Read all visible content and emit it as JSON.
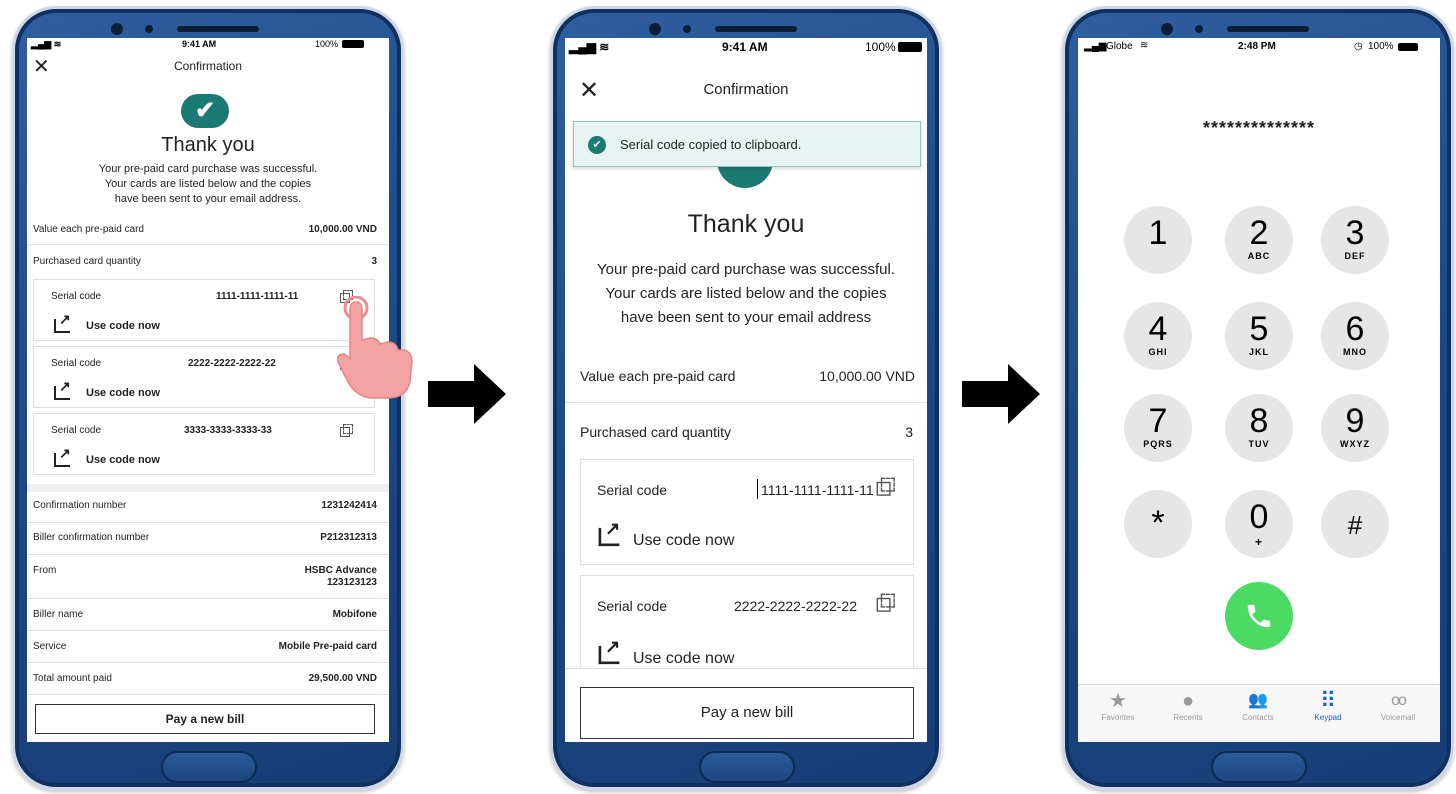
{
  "phone1": {
    "status": {
      "time": "9:41 AM",
      "battery": "100%"
    },
    "header": {
      "close": "✕",
      "title": "Confirmation"
    },
    "thank_title": "Thank you",
    "message": [
      "Your pre-paid card purchase was successful.",
      "Your cards are listed below and the copies",
      "have been sent to your email address."
    ],
    "value_label": "Value each pre-paid card",
    "value": "10,000.00 VND",
    "qty_label": "Purchased card quantity",
    "qty": "3",
    "cards": [
      {
        "label": "Serial code",
        "code": "1111-1111-1111-11",
        "use": "Use code now"
      },
      {
        "label": "Serial code",
        "code": "2222-2222-2222-22",
        "use": "Use code now"
      },
      {
        "label": "Serial code",
        "code": "3333-3333-3333-33",
        "use": "Use code now"
      }
    ],
    "details": [
      {
        "label": "Confirmation number",
        "value": "1231242414"
      },
      {
        "label": "Biller confirmation number",
        "value": "P212312313"
      },
      {
        "label": "From",
        "value": "HSBC Advance",
        "value2": "123123123"
      },
      {
        "label": "Biller name",
        "value": "Mobifone"
      },
      {
        "label": "Service",
        "value": "Mobile Pre-paid card"
      },
      {
        "label": "Total amount paid",
        "value": "29,500.00 VND"
      }
    ],
    "pay_button": "Pay a new bill"
  },
  "phone2": {
    "status": {
      "time": "9:41 AM",
      "battery": "100%"
    },
    "header": {
      "close": "✕",
      "title": "Confirmation"
    },
    "toast": "Serial code copied to clipboard.",
    "thank_title": "Thank you",
    "message": [
      "Your pre-paid card purchase was successful.",
      "Your cards are listed below and the copies",
      "have been sent to your email address"
    ],
    "value_label": "Value each pre-paid card",
    "value": "10,000.00 VND",
    "qty_label": "Purchased card quantity",
    "qty": "3",
    "cards": [
      {
        "label": "Serial code",
        "code": "1111-1111-1111-11",
        "use": "Use code now"
      },
      {
        "label": "Serial code",
        "code": "2222-2222-2222-22",
        "use": "Use code now"
      }
    ],
    "pay_button": "Pay a new bill"
  },
  "phone3": {
    "status": {
      "carrier": "Globe",
      "time": "2:48 PM",
      "battery": "100%"
    },
    "entry": "**************",
    "keys": [
      {
        "num": "1",
        "letters": ""
      },
      {
        "num": "2",
        "letters": "ABC"
      },
      {
        "num": "3",
        "letters": "DEF"
      },
      {
        "num": "4",
        "letters": "GHI"
      },
      {
        "num": "5",
        "letters": "JKL"
      },
      {
        "num": "6",
        "letters": "MNO"
      },
      {
        "num": "7",
        "letters": "PQRS"
      },
      {
        "num": "8",
        "letters": "TUV"
      },
      {
        "num": "9",
        "letters": "WXYZ"
      },
      {
        "num": "*",
        "letters": ""
      },
      {
        "num": "0",
        "letters": "+"
      },
      {
        "num": "#",
        "letters": ""
      }
    ],
    "tabs": [
      {
        "icon": "★",
        "label": "Favorites"
      },
      {
        "icon": "●",
        "label": "Recents"
      },
      {
        "icon": "👥",
        "label": "Contacts"
      },
      {
        "icon": "⠿",
        "label": "Keypad"
      },
      {
        "icon": "oo",
        "label": "Voicemail"
      }
    ]
  },
  "colors": {
    "teal": "#1b7a73",
    "toast_bg": "#e8f3f2",
    "call_green": "#4cd964",
    "keypad_blue": "#1a5fd6",
    "phone_blue": "#1d4a8a"
  }
}
